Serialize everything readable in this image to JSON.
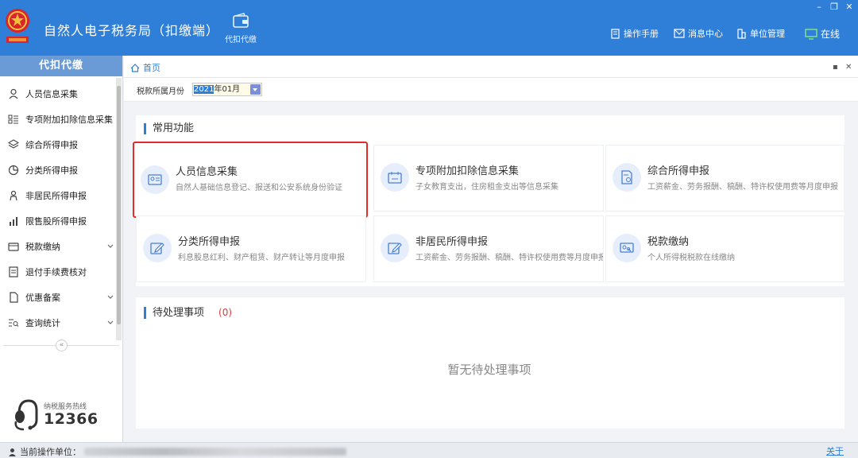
{
  "app": {
    "title": "自然人电子税务局（扣缴端）",
    "func_button": "代扣代缴",
    "nav": {
      "manual": "操作手册",
      "messages": "消息中心",
      "unit_mgmt": "单位管理",
      "online": "在线"
    },
    "window_controls": [
      "–",
      "❐",
      "✕"
    ]
  },
  "sidebar": {
    "header": "代扣代缴",
    "items": [
      {
        "label": "人员信息采集",
        "icon": "user-icon",
        "expandable": false
      },
      {
        "label": "专项附加扣除信息采集",
        "icon": "list-icon",
        "expandable": false
      },
      {
        "label": "综合所得申报",
        "icon": "layers-icon",
        "expandable": false
      },
      {
        "label": "分类所得申报",
        "icon": "pie-icon",
        "expandable": false
      },
      {
        "label": "非居民所得申报",
        "icon": "person-icon",
        "expandable": false
      },
      {
        "label": "限售股所得申报",
        "icon": "bar-chart-icon",
        "expandable": false
      },
      {
        "label": "税款缴纳",
        "icon": "wallet-icon",
        "expandable": true
      },
      {
        "label": "退付手续费核对",
        "icon": "receipt-icon",
        "expandable": false
      },
      {
        "label": "优惠备案",
        "icon": "document-icon",
        "expandable": true
      },
      {
        "label": "查询统计",
        "icon": "search-list-icon",
        "expandable": true
      }
    ],
    "collapse_glyph": "«",
    "hotline_label": "纳税服务热线",
    "hotline_number": "12366"
  },
  "breadcrumb": {
    "home": "首页",
    "controls": [
      "▪",
      "✕"
    ]
  },
  "filter": {
    "label": "税款所属月份",
    "year_selected": "2021",
    "month_rest": "年01月"
  },
  "common": {
    "title": "常用功能",
    "cards": [
      {
        "title": "人员信息采集",
        "desc": "自然人基础信息登记、报送和公安系统身份验证",
        "icon": "id-card-icon",
        "highlighted": true
      },
      {
        "title": "专项附加扣除信息采集",
        "desc": "子女教育支出，住房租金支出等信息采集",
        "icon": "calendar-tax-icon",
        "highlighted": false
      },
      {
        "title": "综合所得申报",
        "desc": "工资薪金、劳务报酬、稿酬、特许权使用费等月度申报",
        "icon": "report-icon",
        "highlighted": false
      },
      {
        "title": "分类所得申报",
        "desc": "利息股息红利、财产租赁、财产转让等月度申报",
        "icon": "edit-icon",
        "highlighted": false
      },
      {
        "title": "非居民所得申报",
        "desc": "工资薪金、劳务报酬、稿酬、特许权使用费等月度申报",
        "icon": "edit-icon",
        "highlighted": false
      },
      {
        "title": "税款缴纳",
        "desc": "个人所得税税款在线缴纳",
        "icon": "payment-icon",
        "highlighted": false
      }
    ]
  },
  "pending": {
    "title": "待处理事项",
    "count": "(0)",
    "empty": "暂无待处理事项"
  },
  "status": {
    "label": "当前操作单位：",
    "about": "关于"
  },
  "colors": {
    "brand": "#2f7fd8",
    "highlight": "#e32b2b",
    "pending_count": "#e03b3b"
  }
}
